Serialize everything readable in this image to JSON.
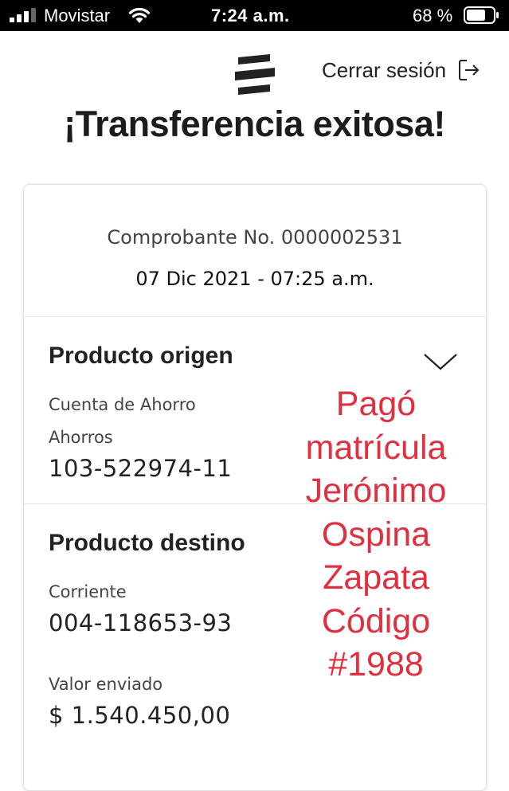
{
  "status_bar": {
    "carrier": "Movistar",
    "time": "7:24 a.m.",
    "battery_percent": "68 %",
    "icons": [
      "signal-icon",
      "wifi-icon",
      "battery-icon"
    ]
  },
  "header": {
    "logo": "bancolombia-logo",
    "logout_label": "Cerrar sesión",
    "logout_icon": "logout-icon"
  },
  "title": "¡Transferencia exitosa!",
  "receipt": {
    "number": "Comprobante No. 0000002531",
    "date": "07 Dic 2021 - 07:25 a.m."
  },
  "origin": {
    "title": "Producto origen",
    "account_type": "Cuenta de Ahorro",
    "account_subtype": "Ahorros",
    "account_number": "103-522974-11",
    "expand_icon": "chevron-down-icon"
  },
  "destination": {
    "title": "Producto destino",
    "account_type": "Corriente",
    "account_number": "004-118653-93",
    "amount_label": "Valor enviado",
    "amount": "$ 1.540.450,00"
  },
  "note": {
    "lines": [
      "Pagó",
      "matrícula",
      "Jerónimo",
      "Ospina",
      "Zapata",
      "Código",
      "#1988"
    ],
    "color": "#e0303f"
  }
}
